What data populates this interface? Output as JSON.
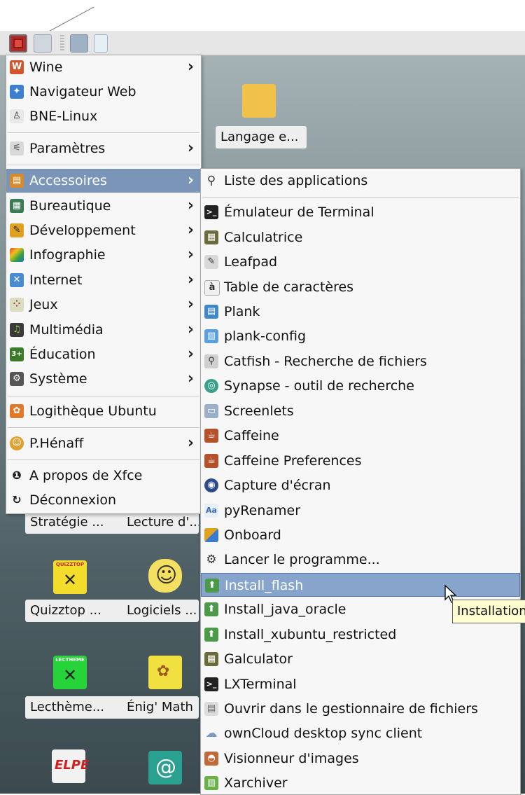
{
  "main_menu": {
    "items": [
      {
        "label": "Wine",
        "icon": "wine-icon",
        "color": "#d2542b",
        "submenu": true
      },
      {
        "label": "Navigateur Web",
        "icon": "web-browser-icon",
        "color": "#3f7fd1",
        "submenu": false
      },
      {
        "label": "BNE-Linux",
        "icon": "bne-linux-icon",
        "color": "#444444",
        "submenu": false
      },
      {
        "label": "Paramètres",
        "icon": "settings-icon",
        "color": "#9a9a9a",
        "submenu": true
      },
      {
        "label": "Accessoires",
        "icon": "accessories-icon",
        "color": "#d98a2b",
        "submenu": true
      },
      {
        "label": "Bureautique",
        "icon": "office-icon",
        "color": "#3c7a54",
        "submenu": true
      },
      {
        "label": "Développement",
        "icon": "development-icon",
        "color": "#e0a020",
        "submenu": true
      },
      {
        "label": "Infographie",
        "icon": "graphics-icon",
        "color": "#d04060",
        "submenu": true
      },
      {
        "label": "Internet",
        "icon": "internet-icon",
        "color": "#4a8ad0",
        "submenu": true
      },
      {
        "label": "Jeux",
        "icon": "games-icon",
        "color": "#c9c9a0",
        "submenu": true
      },
      {
        "label": "Multimédia",
        "icon": "multimedia-icon",
        "color": "#3a3a3a",
        "submenu": true
      },
      {
        "label": "Éducation",
        "icon": "education-icon",
        "color": "#3a7a2a",
        "submenu": true
      },
      {
        "label": "Système",
        "icon": "system-icon",
        "color": "#555555",
        "submenu": true
      },
      {
        "label": "Logithèque Ubuntu",
        "icon": "software-center-icon",
        "color": "#e07a2a",
        "submenu": false
      },
      {
        "label": "P.Hénaff",
        "icon": "user-folder-icon",
        "color": "#e0a030",
        "submenu": true
      },
      {
        "label": "A propos de Xfce",
        "icon": "info-icon",
        "color": "#222222",
        "submenu": false
      },
      {
        "label": "Déconnexion",
        "icon": "logout-icon",
        "color": "#222222",
        "submenu": false
      }
    ]
  },
  "sub_menu": {
    "items": [
      {
        "label": "Liste des applications",
        "icon": "search-icon",
        "color": "#333333"
      },
      {
        "label": "Émulateur de Terminal",
        "icon": "terminal-icon",
        "color": "#222222"
      },
      {
        "label": "Calculatrice",
        "icon": "calculator-icon",
        "color": "#6a6a3a"
      },
      {
        "label": "Leafpad",
        "icon": "text-editor-icon",
        "color": "#b8b8b8"
      },
      {
        "label": "Table de caractères",
        "icon": "character-map-icon",
        "color": "#dddddd"
      },
      {
        "label": "Plank",
        "icon": "plank-icon",
        "color": "#3f88c9"
      },
      {
        "label": "plank-config",
        "icon": "plank-config-icon",
        "color": "#5aa0e0"
      },
      {
        "label": "Catfish - Recherche de fichiers",
        "icon": "file-search-icon",
        "color": "#8a8a8a"
      },
      {
        "label": "Synapse - outil de recherche",
        "icon": "synapse-icon",
        "color": "#3aa08a"
      },
      {
        "label": "Screenlets",
        "icon": "screenlets-icon",
        "color": "#9ab0c8"
      },
      {
        "label": "Caffeine",
        "icon": "caffeine-icon",
        "color": "#b5512a"
      },
      {
        "label": "Caffeine Preferences",
        "icon": "caffeine-preferences-icon",
        "color": "#b5512a"
      },
      {
        "label": "Capture d'écran",
        "icon": "screenshot-icon",
        "color": "#2a4a8a"
      },
      {
        "label": "pyRenamer",
        "icon": "pyrenamer-icon",
        "color": "#6a9ad0"
      },
      {
        "label": "Onboard",
        "icon": "onboard-keyboard-icon",
        "color": "#e0a020"
      },
      {
        "label": "Lancer le programme...",
        "icon": "gear-icon",
        "color": "#333333"
      },
      {
        "label": "Install_flash",
        "icon": "installer-icon",
        "color": "#4a9a4a"
      },
      {
        "label": "Install_java_oracle",
        "icon": "installer-icon",
        "color": "#4a9a4a"
      },
      {
        "label": "Install_xubuntu_restricted",
        "icon": "installer-icon",
        "color": "#4a9a4a"
      },
      {
        "label": "Galculator",
        "icon": "calculator-icon",
        "color": "#6a6a3a"
      },
      {
        "label": "LXTerminal",
        "icon": "terminal-icon",
        "color": "#222222"
      },
      {
        "label": "Ouvrir dans le gestionnaire de fichiers",
        "icon": "file-manager-icon",
        "color": "#bbbbbb"
      },
      {
        "label": "ownCloud desktop sync client",
        "icon": "owncloud-icon",
        "color": "#7a9ac0"
      },
      {
        "label": "Visionneur d'images",
        "icon": "image-viewer-icon",
        "color": "#c06a3a"
      },
      {
        "label": "Xarchiver",
        "icon": "archive-icon",
        "color": "#6ab04a"
      }
    ]
  },
  "tooltip": "Installation",
  "desktop_icons": {
    "langage": "Langage e...",
    "strategie": "Stratégie ...",
    "lecture": "Lecture d'...",
    "quizztop": "Quizztop ...",
    "logiciels": "Logiciels ...",
    "lectheme": "Lecthème...",
    "enig_math": "Énig' Math",
    "quizztop_logo": "QUIZZTOP",
    "lectheme_logo": "LECTHEME",
    "elpe_logo": "ELPE"
  }
}
